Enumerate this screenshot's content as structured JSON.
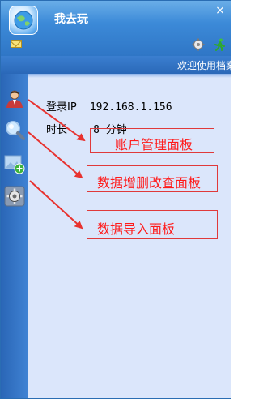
{
  "window": {
    "title": "我去玩",
    "close_glyph": "×",
    "welcome": "欢迎使用档案"
  },
  "colors": {
    "titlebar": "#3c8ad8",
    "sidebar": "#2a66b6",
    "content_bg": "#dbe6fb",
    "annotation": "#e0393a"
  },
  "sidebar": {
    "items": [
      {
        "icon": "user-icon"
      },
      {
        "icon": "search-icon"
      },
      {
        "icon": "image-add-icon"
      },
      {
        "icon": "gear-icon"
      }
    ]
  },
  "info": {
    "ip_label": "登录IP",
    "ip_value": "192.168.1.156",
    "time_label": "时长",
    "time_value": "8 分钟"
  },
  "annotations": {
    "account": "账户管理面板",
    "data_crud": "数据增删改查面板",
    "data_import": "数据导入面板"
  }
}
